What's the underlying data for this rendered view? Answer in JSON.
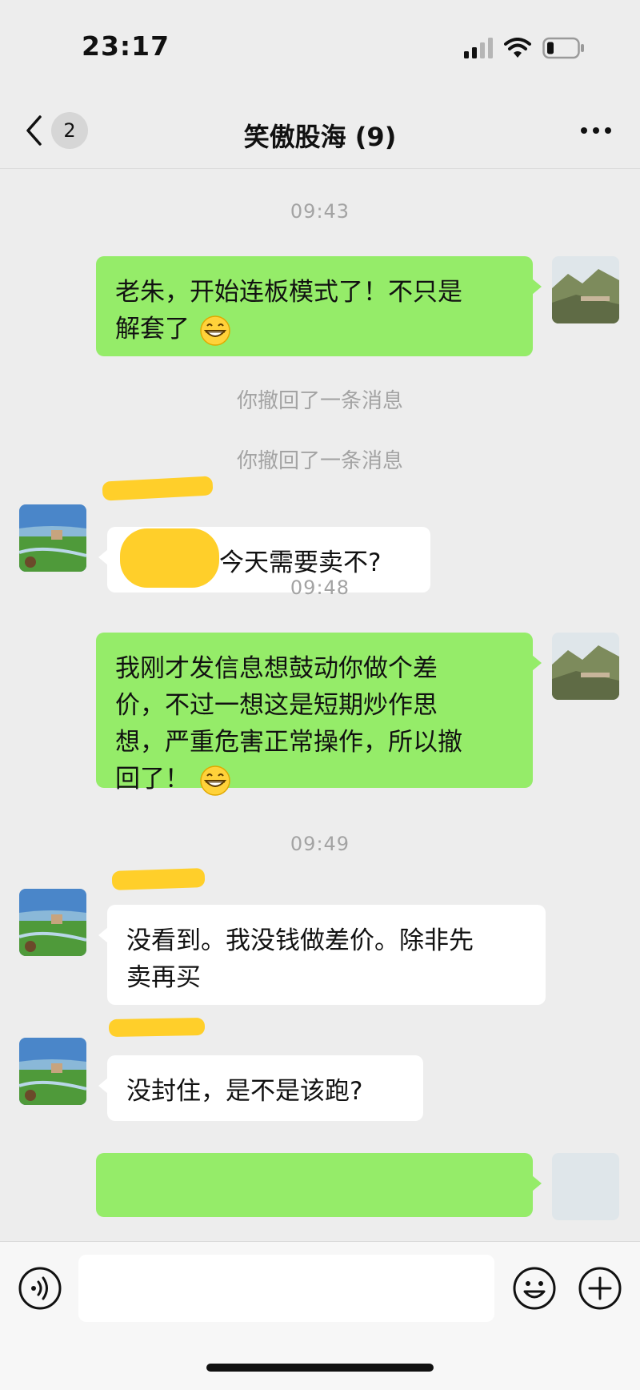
{
  "status_bar": {
    "time": "23:17"
  },
  "nav": {
    "back_count": "2",
    "title": "笑傲股海 (9)"
  },
  "chat": {
    "time_1": "09:43",
    "msg_1_line1": "老朱，开始连板模式了！不只是",
    "msg_1_line2": "解套了",
    "recall_1": "你撤回了一条消息",
    "recall_2": "你撤回了一条消息",
    "msg_2": "今天需要卖不?",
    "time_2": "09:48",
    "msg_3_line1": "我刚才发信息想鼓动你做个差",
    "msg_3_line2": "价，不过一想这是短期炒作思",
    "msg_3_line3": "想，严重危害正常操作，所以撤",
    "msg_3_line4": "回了！",
    "time_3": "09:49",
    "msg_4_line1": "没看到。我没钱做差价。除非先",
    "msg_4_line2": "卖再买",
    "msg_5": "没封住，是不是该跑?"
  },
  "icons": {
    "grin": "grinning-face-with-smiling-eyes",
    "voice": "voice-icon",
    "emoji": "emoji-icon",
    "plus": "plus-icon"
  },
  "colors": {
    "outgoing_bubble": "#95ec69",
    "incoming_bubble": "#ffffff",
    "background": "#ededed",
    "timestamp": "#a3a3a3"
  }
}
